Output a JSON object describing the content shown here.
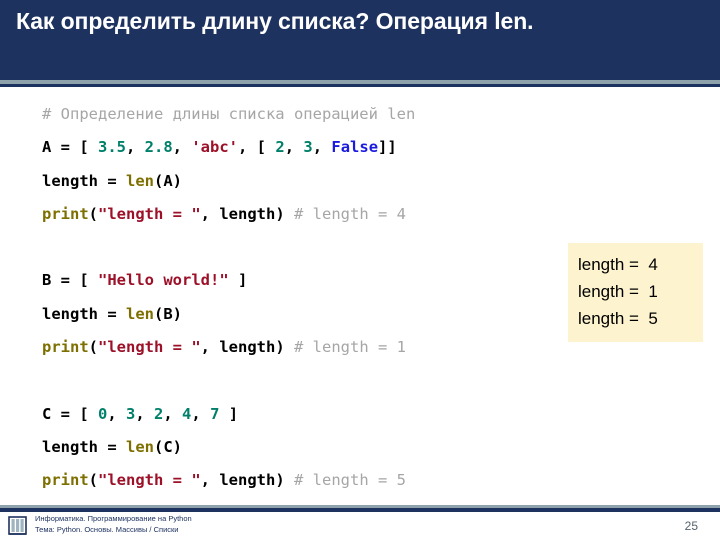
{
  "slide": {
    "title": "Как определить длину списка? Операция len.",
    "page_number": "25"
  },
  "colors": {
    "header_bg": "#1e3260",
    "header_text": "#ffffff",
    "accent_rule": "#8fa3ad",
    "callout_bg": "#fdf3cf",
    "comment": "#a6a6a6",
    "number": "#00806a",
    "string": "#9c1028",
    "keyword": "#1a1ae0",
    "builtin": "#7d7000",
    "footer_text": "#1e3260"
  },
  "code": {
    "lines": [
      {
        "id": "line-comment-1",
        "tokens": [
          {
            "t": "# Определение длины списка операцией len",
            "c": "comment"
          }
        ]
      },
      {
        "id": "line-a-assign",
        "tokens": [
          {
            "t": "A = [ ",
            "c": "plain"
          },
          {
            "t": "3.5",
            "c": "num"
          },
          {
            "t": ", ",
            "c": "plain"
          },
          {
            "t": "2.8",
            "c": "num"
          },
          {
            "t": ", ",
            "c": "plain"
          },
          {
            "t": "'abc'",
            "c": "str"
          },
          {
            "t": ", [ ",
            "c": "plain"
          },
          {
            "t": "2",
            "c": "num"
          },
          {
            "t": ", ",
            "c": "plain"
          },
          {
            "t": "3",
            "c": "num"
          },
          {
            "t": ", ",
            "c": "plain"
          },
          {
            "t": "False",
            "c": "kw"
          },
          {
            "t": "]]",
            "c": "plain"
          }
        ]
      },
      {
        "id": "line-len-a",
        "tokens": [
          {
            "t": "length = ",
            "c": "plain"
          },
          {
            "t": "len",
            "c": "fn"
          },
          {
            "t": "(A)",
            "c": "plain"
          }
        ]
      },
      {
        "id": "line-print-a",
        "tokens": [
          {
            "t": "print",
            "c": "fn"
          },
          {
            "t": "(",
            "c": "plain"
          },
          {
            "t": "\"length = \"",
            "c": "str"
          },
          {
            "t": ", length) ",
            "c": "plain"
          },
          {
            "t": "# length = 4",
            "c": "comment"
          }
        ]
      },
      {
        "id": "line-blank-1",
        "tokens": []
      },
      {
        "id": "line-b-assign",
        "tokens": [
          {
            "t": "B = [ ",
            "c": "plain"
          },
          {
            "t": "\"Hello world!\"",
            "c": "str"
          },
          {
            "t": " ]",
            "c": "plain"
          }
        ]
      },
      {
        "id": "line-len-b",
        "tokens": [
          {
            "t": "length = ",
            "c": "plain"
          },
          {
            "t": "len",
            "c": "fn"
          },
          {
            "t": "(B)",
            "c": "plain"
          }
        ]
      },
      {
        "id": "line-print-b",
        "tokens": [
          {
            "t": "print",
            "c": "fn"
          },
          {
            "t": "(",
            "c": "plain"
          },
          {
            "t": "\"length = \"",
            "c": "str"
          },
          {
            "t": ", length) ",
            "c": "plain"
          },
          {
            "t": "# length = 1",
            "c": "comment"
          }
        ]
      },
      {
        "id": "line-blank-2",
        "tokens": []
      },
      {
        "id": "line-c-assign",
        "tokens": [
          {
            "t": "C = [ ",
            "c": "plain"
          },
          {
            "t": "0",
            "c": "num"
          },
          {
            "t": ", ",
            "c": "plain"
          },
          {
            "t": "3",
            "c": "num"
          },
          {
            "t": ", ",
            "c": "plain"
          },
          {
            "t": "2",
            "c": "num"
          },
          {
            "t": ", ",
            "c": "plain"
          },
          {
            "t": "4",
            "c": "num"
          },
          {
            "t": ", ",
            "c": "plain"
          },
          {
            "t": "7",
            "c": "num"
          },
          {
            "t": " ]",
            "c": "plain"
          }
        ]
      },
      {
        "id": "line-len-c",
        "tokens": [
          {
            "t": "length = ",
            "c": "plain"
          },
          {
            "t": "len",
            "c": "fn"
          },
          {
            "t": "(C)",
            "c": "plain"
          }
        ]
      },
      {
        "id": "line-print-c",
        "tokens": [
          {
            "t": "print",
            "c": "fn"
          },
          {
            "t": "(",
            "c": "plain"
          },
          {
            "t": "\"length = \"",
            "c": "str"
          },
          {
            "t": ", length) ",
            "c": "plain"
          },
          {
            "t": "# length = 5",
            "c": "comment"
          }
        ]
      }
    ]
  },
  "output": {
    "lines": [
      "length =  4",
      "length =  1",
      "length =  5"
    ]
  },
  "footer": {
    "line1": "Информатика. Программирование на Python",
    "line2": "Тема: Python. Основы. Массивы / Списки"
  }
}
